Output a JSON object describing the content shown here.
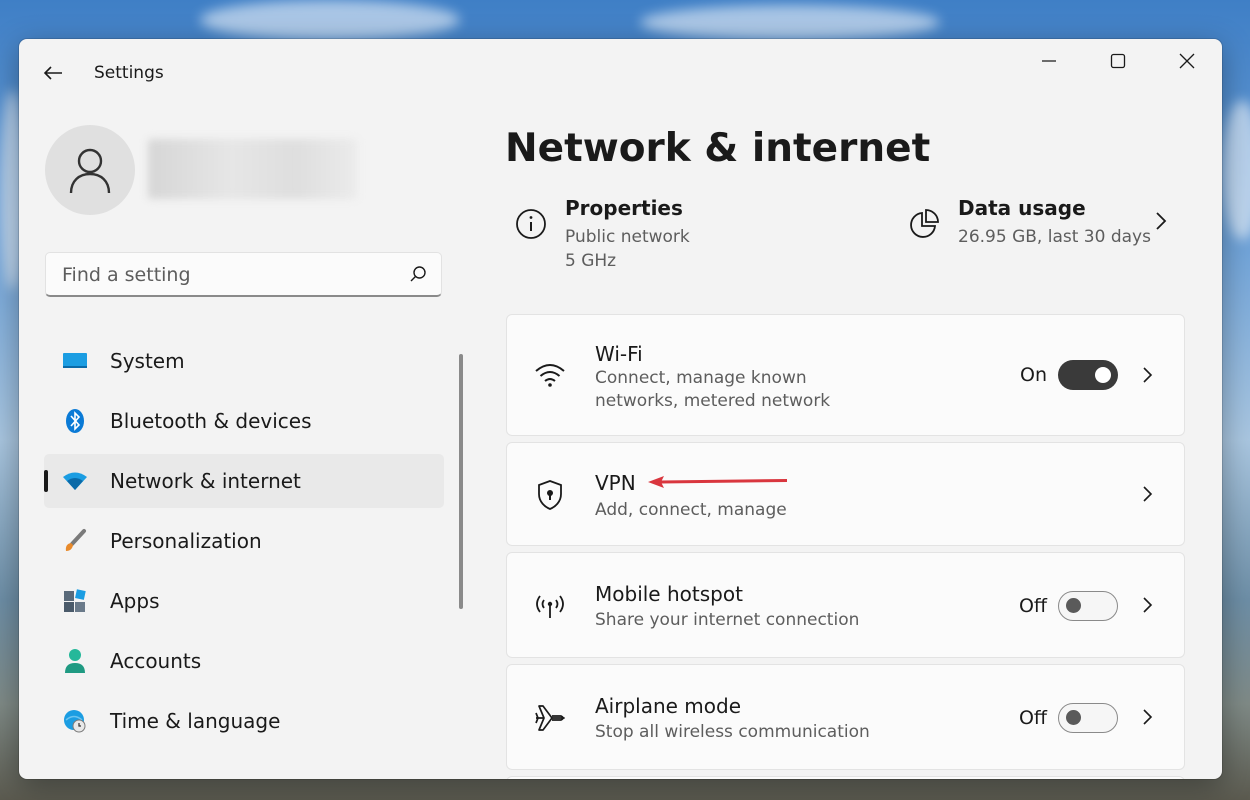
{
  "window": {
    "title": "Settings"
  },
  "search": {
    "placeholder": "Find a setting"
  },
  "sidebar": {
    "items": [
      {
        "label": "System",
        "icon": "system-icon"
      },
      {
        "label": "Bluetooth & devices",
        "icon": "bluetooth-icon"
      },
      {
        "label": "Network & internet",
        "icon": "wifi-icon",
        "selected": true
      },
      {
        "label": "Personalization",
        "icon": "brush-icon"
      },
      {
        "label": "Apps",
        "icon": "apps-icon"
      },
      {
        "label": "Accounts",
        "icon": "person-icon"
      },
      {
        "label": "Time & language",
        "icon": "globe-clock-icon"
      }
    ]
  },
  "main": {
    "title": "Network & internet",
    "properties": {
      "title": "Properties",
      "line1": "Public network",
      "line2": "5 GHz",
      "icon": "info-icon"
    },
    "data_usage": {
      "title": "Data usage",
      "subtitle": "26.95 GB, last 30 days",
      "icon": "pie-chart-icon"
    },
    "cards": [
      {
        "title": "Wi-Fi",
        "subtitle": "Connect, manage known networks, metered network",
        "state": "On",
        "toggle": true,
        "icon": "wifi-icon"
      },
      {
        "title": "VPN",
        "subtitle": "Add, connect, manage",
        "icon": "shield-icon"
      },
      {
        "title": "Mobile hotspot",
        "subtitle": "Share your internet connection",
        "state": "Off",
        "toggle": false,
        "icon": "hotspot-icon"
      },
      {
        "title": "Airplane mode",
        "subtitle": "Stop all wireless communication",
        "state": "Off",
        "toggle": false,
        "icon": "airplane-icon"
      }
    ]
  },
  "colors": {
    "accent": "#0067c0",
    "annotation_arrow": "#d9363e",
    "toggle_on": "#3a3a3a"
  }
}
